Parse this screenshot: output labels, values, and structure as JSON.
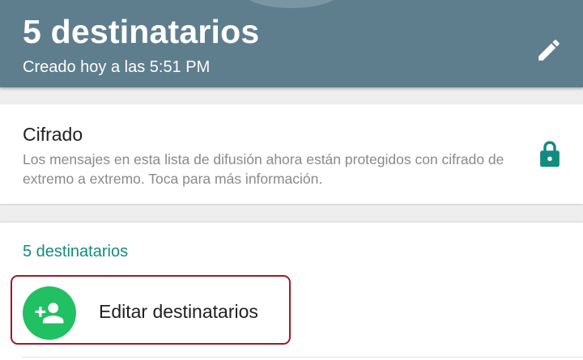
{
  "header": {
    "title": "5 destinatarios",
    "subtitle": "Creado hoy a las 5:51 PM",
    "background_color": "#5e7e8e",
    "edit_icon": "pencil-icon"
  },
  "encryption": {
    "title": "Cifrado",
    "description": "Los mensajes en esta lista de difusión ahora están protegidos con cifrado de extremo a extremo. Toca para más información.",
    "icon": "lock-icon",
    "icon_color": "#128c7e"
  },
  "recipients": {
    "section_label": "5 destinatarios",
    "accent_color": "#128c7e",
    "edit_action": {
      "label": "Editar destinatarios",
      "icon": "add-person-icon",
      "icon_background": "#21c063",
      "highlight_color": "#a31824"
    }
  }
}
